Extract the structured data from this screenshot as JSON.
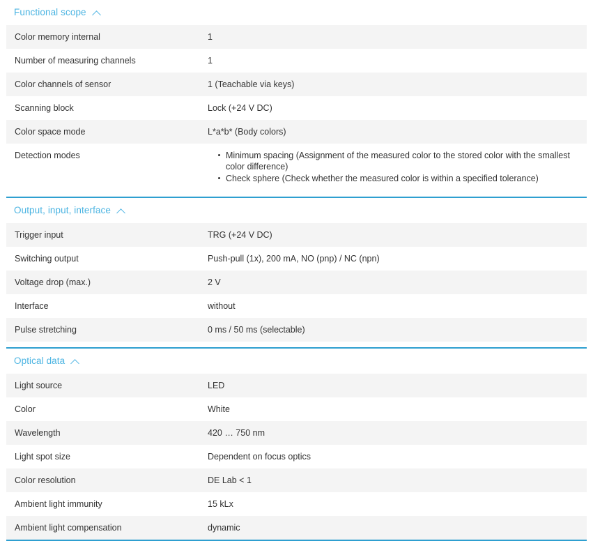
{
  "accent_color": "#4bb4e2",
  "rule_color": "#2e9fd0",
  "row_alt_color": "#f4f4f4",
  "text_color": "#333333",
  "sections": [
    {
      "title": "Functional scope",
      "toggle_icon": "chevron-up-icon",
      "rows": [
        {
          "label": "Color memory internal",
          "value": "1"
        },
        {
          "label": "Number of measuring channels",
          "value": "1"
        },
        {
          "label": "Color channels of sensor",
          "value": "1 (Teachable via keys)"
        },
        {
          "label": "Scanning block",
          "value": "Lock (+24 V DC)"
        },
        {
          "label": "Color space mode",
          "value": "L*a*b* (Body colors)"
        },
        {
          "label": "Detection modes",
          "bullets": [
            "Minimum spacing (Assignment of the measured color to the stored color with the smallest color difference)",
            "Check sphere (Check whether the measured color is within a specified tolerance)"
          ]
        }
      ]
    },
    {
      "title": "Output, input, interface",
      "toggle_icon": "chevron-up-icon",
      "rows": [
        {
          "label": "Trigger input",
          "value": "TRG (+24 V DC)"
        },
        {
          "label": "Switching output",
          "value": "Push-pull (1x), 200 mA, NO (pnp) / NC (npn)"
        },
        {
          "label": "Voltage drop (max.)",
          "value": "2 V"
        },
        {
          "label": "Interface",
          "value": "without"
        },
        {
          "label": "Pulse stretching",
          "value": "0 ms / 50 ms (selectable)"
        }
      ]
    },
    {
      "title": "Optical data",
      "toggle_icon": "chevron-up-icon",
      "rows": [
        {
          "label": "Light source",
          "value": "LED"
        },
        {
          "label": "Color",
          "value": "White"
        },
        {
          "label": "Wavelength",
          "value": "420 … 750 nm"
        },
        {
          "label": "Light spot size",
          "value": "Dependent on focus optics"
        },
        {
          "label": "Color resolution",
          "value": "DE Lab < 1"
        },
        {
          "label": "Ambient light immunity",
          "value": "15 kLx"
        },
        {
          "label": "Ambient light compensation",
          "value": "dynamic"
        }
      ]
    }
  ]
}
